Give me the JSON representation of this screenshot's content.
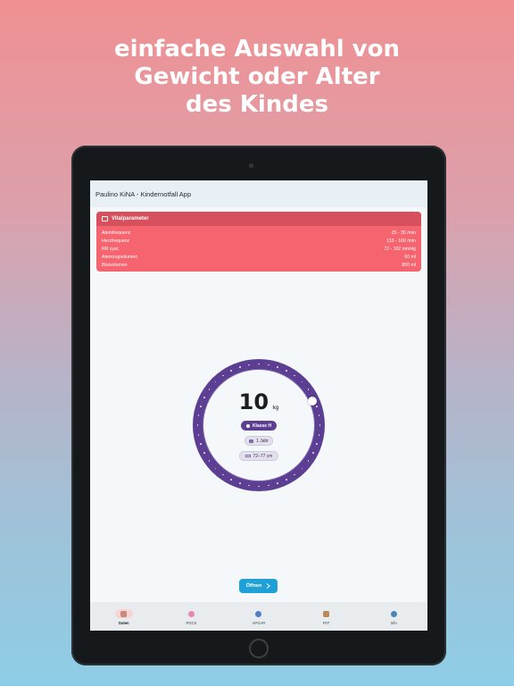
{
  "headline": {
    "line1": "einfache Auswahl von",
    "line2": "Gewicht oder Alter",
    "line3": "des Kindes"
  },
  "app": {
    "title": "Paulino KiNA - Kindernotfall App"
  },
  "vital_card": {
    "title": "Vitalparameter",
    "icon": "monitor-icon",
    "rows": [
      {
        "label": "Atemfrequenz",
        "value": "25 - 35 /min"
      },
      {
        "label": "Herzfrequenz",
        "value": "110 - 160 /min"
      },
      {
        "label": "RR syst.",
        "value": "72 - 102 mmHg"
      },
      {
        "label": "Atemzugvolumen",
        "value": "60 ml"
      },
      {
        "label": "Blutvolumen",
        "value": "800 ml"
      }
    ]
  },
  "selector": {
    "weight_value": "10",
    "weight_unit": "kg",
    "class_label": "Klasse H",
    "age_label": "1 Jahr",
    "length_label": "72–77 cm",
    "ring_color": "#5c3f93"
  },
  "open_button": {
    "label": "Öffnen",
    "icon": "chevron-right-icon",
    "color": "#1fa0d6"
  },
  "nav": {
    "items": [
      {
        "label": "Daten",
        "icon": "baby-icon",
        "color": "#c98a7d"
      },
      {
        "label": "PGCS",
        "icon": "brain-icon",
        "color": "#e78aa9"
      },
      {
        "label": "APGAR",
        "icon": "stethoscope-icon",
        "color": "#4f7fc9"
      },
      {
        "label": "PAT",
        "icon": "clipboard-icon",
        "color": "#b98a57"
      },
      {
        "label": "Info",
        "icon": "info-icon",
        "color": "#4a86b5"
      }
    ],
    "active": "Daten"
  }
}
